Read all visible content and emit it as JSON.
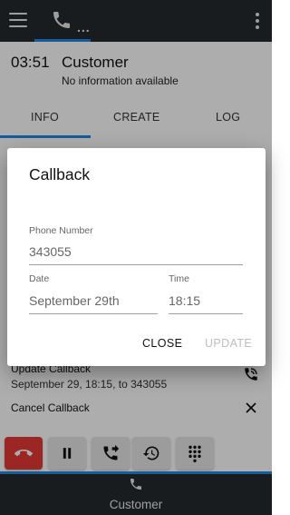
{
  "topbar": {
    "menu_icon": "hamburger-icon",
    "call_tab_icon": "phone-icon",
    "call_tab_dots": "...",
    "more_icon": "kebab-icon"
  },
  "header": {
    "timer": "03:51",
    "title": "Customer",
    "subtitle": "No information available"
  },
  "tabs": [
    {
      "label": "INFO",
      "active": true
    },
    {
      "label": "CREATE",
      "active": false
    },
    {
      "label": "LOG",
      "active": false
    }
  ],
  "list": {
    "update": {
      "title": "Update Callback",
      "subtitle": "September 29, 18:15, to 343055",
      "icon": "phone-callback-icon"
    },
    "cancel": {
      "title": "Cancel Callback",
      "icon": "close-icon"
    }
  },
  "actions": [
    {
      "name": "hangup",
      "icon": "phone-hangup-icon"
    },
    {
      "name": "hold",
      "icon": "pause-icon"
    },
    {
      "name": "transfer",
      "icon": "phone-forward-icon"
    },
    {
      "name": "history",
      "icon": "history-icon"
    },
    {
      "name": "dialpad",
      "icon": "dialpad-icon"
    }
  ],
  "bottombar": {
    "icon": "phone-icon",
    "label": "Customer"
  },
  "dialog": {
    "title": "Callback",
    "phone_label": "Phone Number",
    "phone_value": "343055",
    "date_label": "Date",
    "date_value": "September 29th",
    "time_label": "Time",
    "time_value": "18:15",
    "close_label": "CLOSE",
    "update_label": "UPDATE"
  },
  "colors": {
    "accent": "#1e88e5",
    "appbar": "#262a2f",
    "hangup": "#e53935"
  }
}
